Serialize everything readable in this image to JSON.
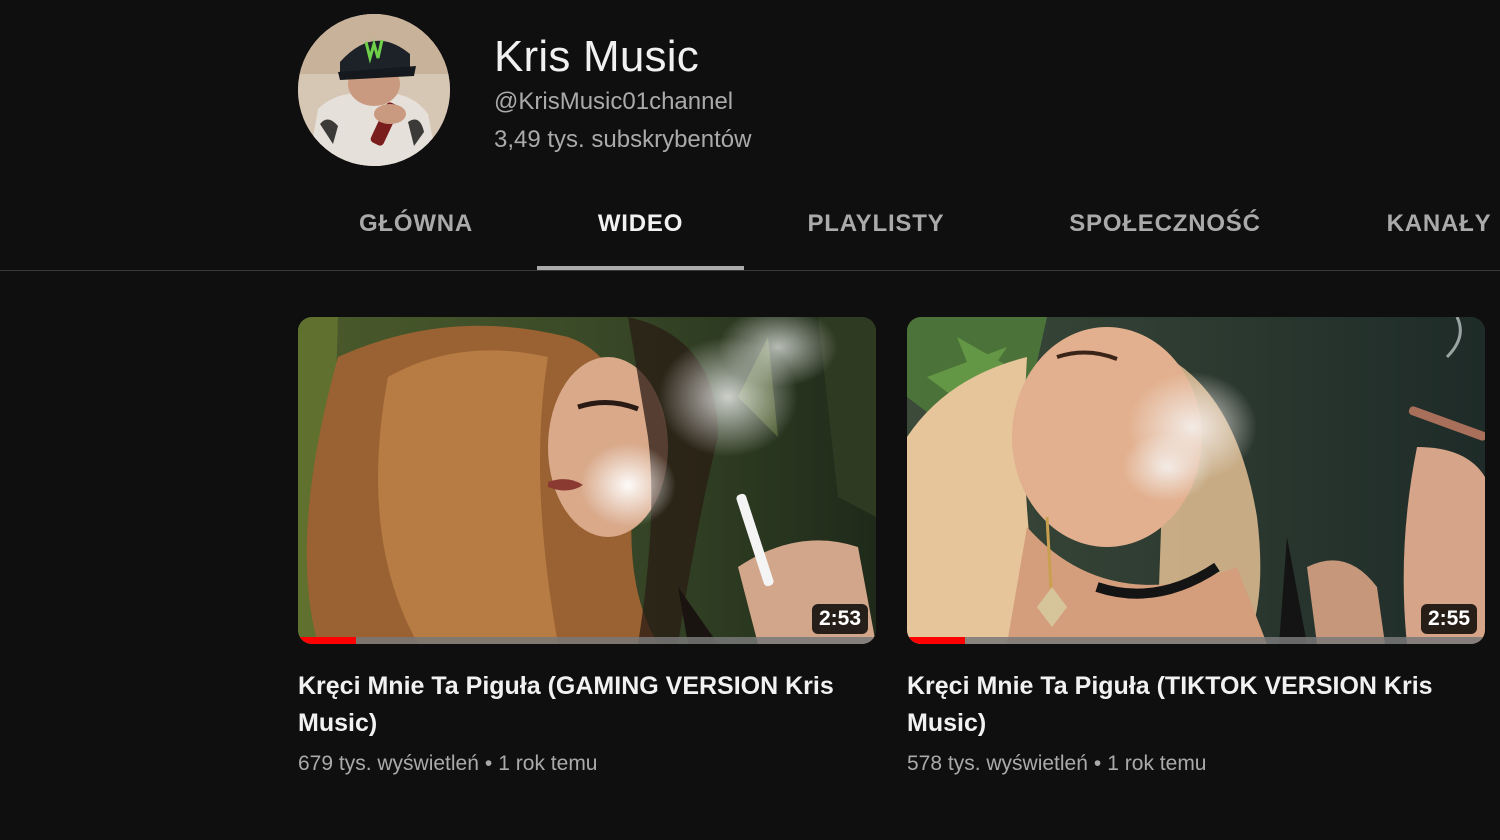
{
  "channel": {
    "name": "Kris Music",
    "handle": "@KrisMusic01channel",
    "subscribers": "3,49 tys. subskrybentów"
  },
  "tabs": [
    {
      "label": "GŁÓWNA",
      "active": false
    },
    {
      "label": "WIDEO",
      "active": true
    },
    {
      "label": "PLAYLISTY",
      "active": false
    },
    {
      "label": "SPOŁECZNOŚĆ",
      "active": false
    },
    {
      "label": "KANAŁY",
      "active": false
    }
  ],
  "videos": [
    {
      "title": "Kręci Mnie Ta Piguła (GAMING VERSION Kris Music)",
      "duration": "2:53",
      "views": "679 tys. wyświetleń",
      "separator": "•",
      "age": "1 rok temu",
      "watched_fraction": 0.1
    },
    {
      "title": "Kręci Mnie Ta Piguła (TIKTOK VERSION Kris Music)",
      "duration": "2:55",
      "views": "578 tys. wyświetleń",
      "separator": "•",
      "age": "1 rok temu",
      "watched_fraction": 0.1
    }
  ],
  "colors": {
    "background": "#0f0f0f",
    "text_primary": "#f1f1f1",
    "text_secondary": "#aaaaaa",
    "progress": "#ff0000"
  }
}
